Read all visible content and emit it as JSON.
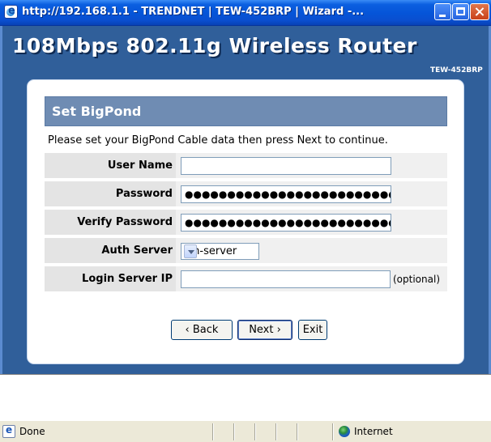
{
  "window": {
    "title": "http://192.168.1.1 - TRENDNET | TEW-452BRP | Wizard -..."
  },
  "header": {
    "brand": "108Mbps 802.11g Wireless Router",
    "model": "TEW-452BRP"
  },
  "panel": {
    "title": "Set BigPond",
    "instruction": "Please set your BigPond Cable data then press Next to continue."
  },
  "form": {
    "user_name": {
      "label": "User Name",
      "value": ""
    },
    "password": {
      "label": "Password",
      "value": "●●●●●●●●●●●●●●●●●●●●●●●●●●●"
    },
    "verify_password": {
      "label": "Verify Password",
      "value": "●●●●●●●●●●●●●●●●●●●●●●●●●●●"
    },
    "auth_server": {
      "label": "Auth Server",
      "selected": "sm-server"
    },
    "login_server_ip": {
      "label": "Login Server IP",
      "value": "",
      "hint": "(optional)"
    }
  },
  "buttons": {
    "back": "‹ Back",
    "next": "Next ›",
    "exit": "Exit"
  },
  "statusbar": {
    "text": "Done",
    "zone": "Internet"
  }
}
